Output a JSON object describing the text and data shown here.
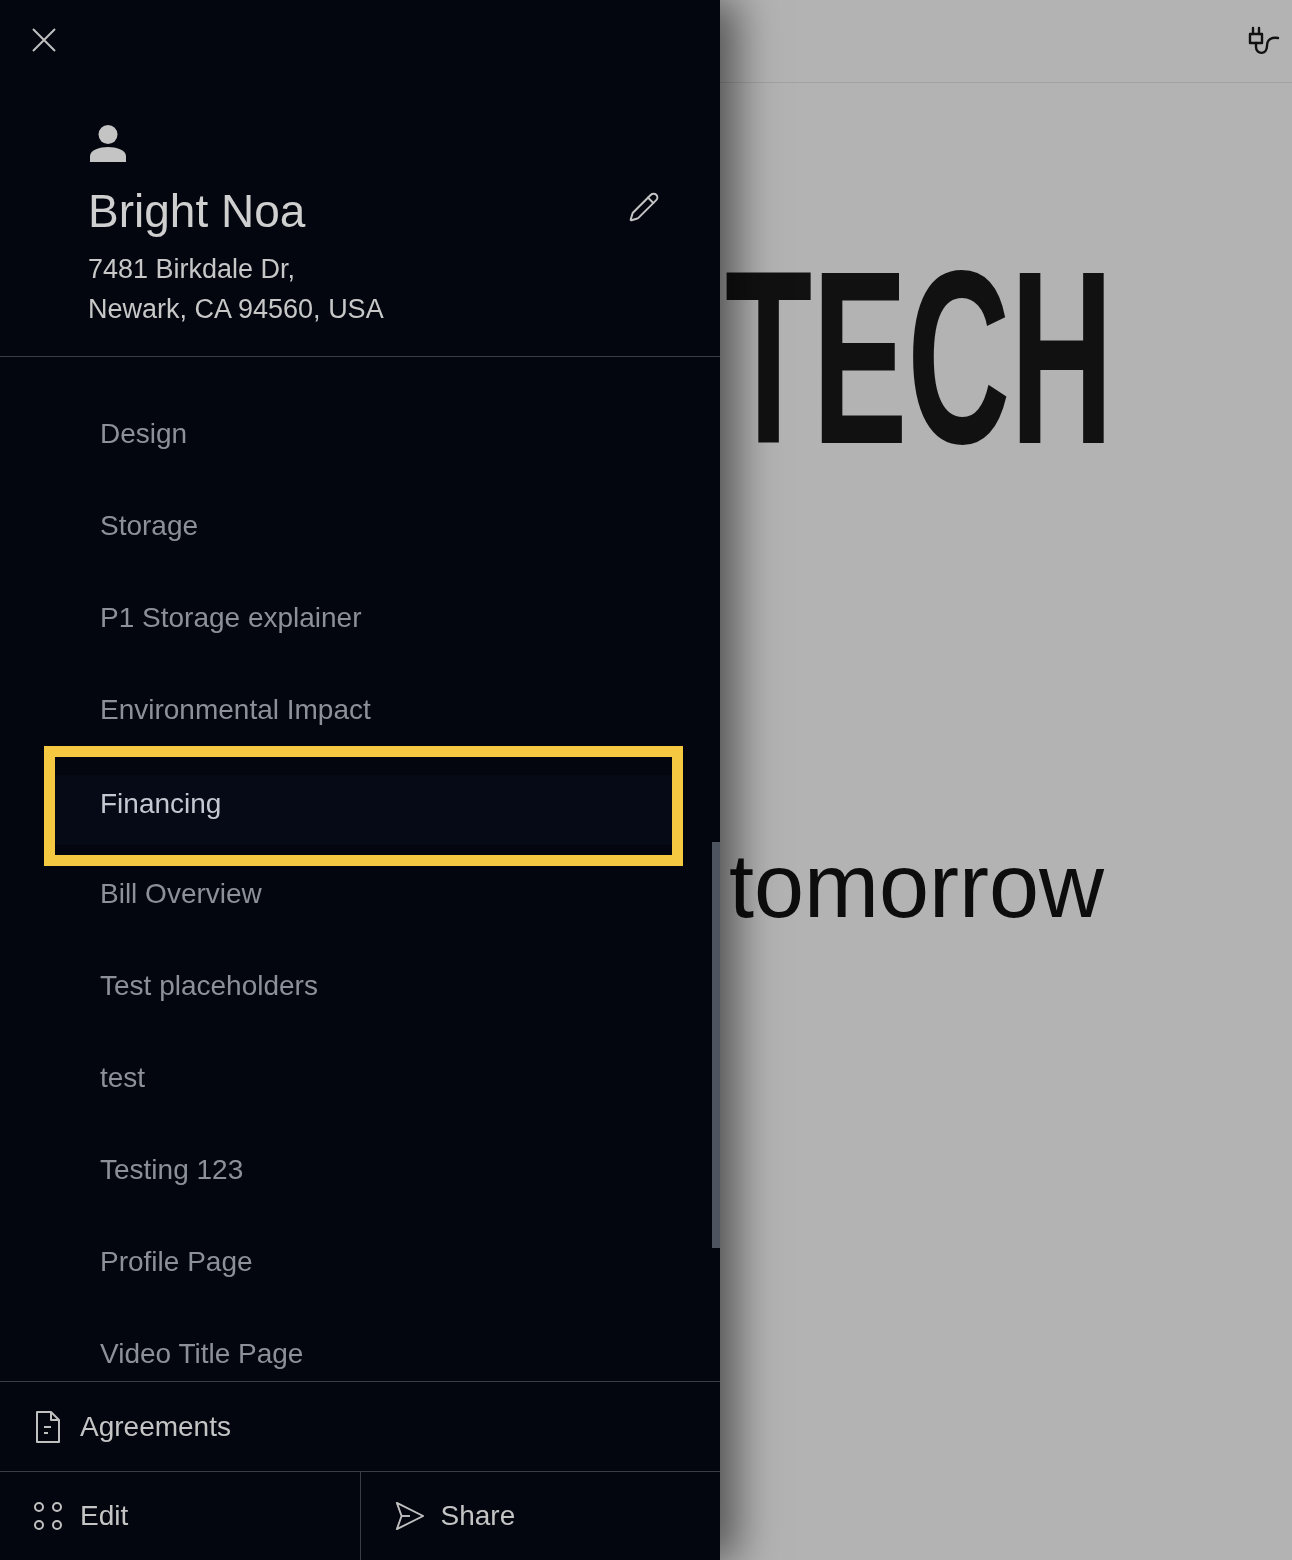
{
  "drawer": {
    "profile": {
      "name": "Bright Noa",
      "address_lines": [
        "7481 Birkdale Dr,",
        "Newark, CA 94560, USA"
      ]
    },
    "nav_items": [
      {
        "label": "Design",
        "selected": false
      },
      {
        "label": "Storage",
        "selected": false
      },
      {
        "label": "P1 Storage explainer",
        "selected": false
      },
      {
        "label": "Environmental Impact",
        "selected": false
      },
      {
        "label": "Financing",
        "selected": true
      },
      {
        "label": "Bill Overview",
        "selected": false
      },
      {
        "label": "Test placeholders",
        "selected": false
      },
      {
        "label": "test",
        "selected": false
      },
      {
        "label": "Testing 123",
        "selected": false
      },
      {
        "label": "Profile Page",
        "selected": false
      },
      {
        "label": "Video Title Page",
        "selected": false
      }
    ],
    "footer": {
      "agreements": "Agreements",
      "edit": "Edit",
      "share": "Share"
    }
  },
  "page": {
    "headline": "TECH",
    "subline": "tomorrow"
  }
}
